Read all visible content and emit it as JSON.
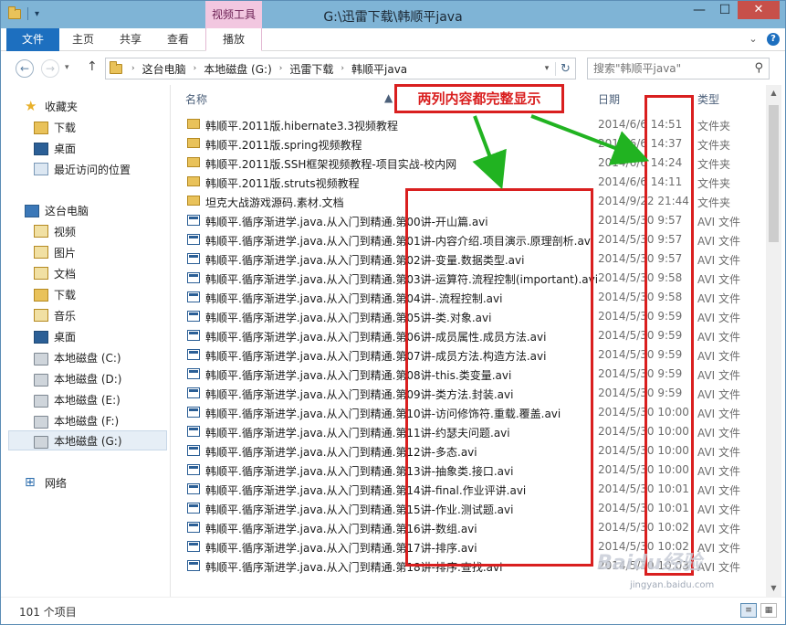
{
  "window": {
    "title": "G:\\迅雷下载\\韩顺平java",
    "context_tool": "视频工具",
    "min_glyph": "—",
    "max_glyph": "☐",
    "close_glyph": "✕"
  },
  "ribbon": {
    "tabs": [
      "文件",
      "主页",
      "共享",
      "查看",
      "播放"
    ]
  },
  "address": {
    "crumbs": [
      "这台电脑",
      "本地磁盘 (G:)",
      "迅雷下载",
      "韩顺平java"
    ]
  },
  "search": {
    "placeholder": "搜索\"韩顺平java\""
  },
  "navpane": {
    "items": [
      {
        "label": "收藏夹",
        "icon": "star-icon"
      },
      {
        "label": "下载",
        "icon": "folder-icon"
      },
      {
        "label": "桌面",
        "icon": "desktop-icon"
      },
      {
        "label": "最近访问的位置",
        "icon": "recent-icon"
      },
      {
        "label": "这台电脑",
        "icon": "computer-icon"
      },
      {
        "label": "视频",
        "icon": "library-icon"
      },
      {
        "label": "图片",
        "icon": "library-icon"
      },
      {
        "label": "文档",
        "icon": "library-icon"
      },
      {
        "label": "下载",
        "icon": "folder-icon"
      },
      {
        "label": "音乐",
        "icon": "library-icon"
      },
      {
        "label": "桌面",
        "icon": "desktop-icon"
      },
      {
        "label": "本地磁盘 (C:)",
        "icon": "drive-icon"
      },
      {
        "label": "本地磁盘 (D:)",
        "icon": "drive-icon"
      },
      {
        "label": "本地磁盘 (E:)",
        "icon": "drive-icon"
      },
      {
        "label": "本地磁盘 (F:)",
        "icon": "drive-icon"
      },
      {
        "label": "本地磁盘 (G:)",
        "icon": "drive-icon"
      },
      {
        "label": "网络",
        "icon": "network-icon"
      }
    ]
  },
  "columns": {
    "name": "名称",
    "date": "日期",
    "type": "类型"
  },
  "files": [
    {
      "name": "韩顺平.2011版.hibernate3.3视频教程",
      "date": "2014/6/6 14:51",
      "type": "文件夹",
      "kind": "folder"
    },
    {
      "name": "韩顺平.2011版.spring视频教程",
      "date": "2014/6/6 14:37",
      "type": "文件夹",
      "kind": "folder"
    },
    {
      "name": "韩顺平.2011版.SSH框架视频教程-项目实战-校内网",
      "date": "2014/6/6 14:24",
      "type": "文件夹",
      "kind": "folder"
    },
    {
      "name": "韩顺平.2011版.struts视频教程",
      "date": "2014/6/6 14:11",
      "type": "文件夹",
      "kind": "folder"
    },
    {
      "name": "坦克大战游戏源码.素材.文档",
      "date": "2014/9/22 21:44",
      "type": "文件夹",
      "kind": "folder"
    },
    {
      "name": "韩顺平.循序渐进学.java.从入门到精通.第00讲-开山篇.avi",
      "date": "2014/5/30 9:57",
      "type": "AVI 文件",
      "kind": "video"
    },
    {
      "name": "韩顺平.循序渐进学.java.从入门到精通.第01讲-内容介绍.项目演示.原理剖析.avi",
      "date": "2014/5/30 9:57",
      "type": "AVI 文件",
      "kind": "video"
    },
    {
      "name": "韩顺平.循序渐进学.java.从入门到精通.第02讲-变量.数据类型.avi",
      "date": "2014/5/30 9:57",
      "type": "AVI 文件",
      "kind": "video"
    },
    {
      "name": "韩顺平.循序渐进学.java.从入门到精通.第03讲-运算符.流程控制(important).avi",
      "date": "2014/5/30 9:58",
      "type": "AVI 文件",
      "kind": "video"
    },
    {
      "name": "韩顺平.循序渐进学.java.从入门到精通.第04讲-.流程控制.avi",
      "date": "2014/5/30 9:58",
      "type": "AVI 文件",
      "kind": "video"
    },
    {
      "name": "韩顺平.循序渐进学.java.从入门到精通.第05讲-类.对象.avi",
      "date": "2014/5/30 9:59",
      "type": "AVI 文件",
      "kind": "video"
    },
    {
      "name": "韩顺平.循序渐进学.java.从入门到精通.第06讲-成员属性.成员方法.avi",
      "date": "2014/5/30 9:59",
      "type": "AVI 文件",
      "kind": "video"
    },
    {
      "name": "韩顺平.循序渐进学.java.从入门到精通.第07讲-成员方法.构造方法.avi",
      "date": "2014/5/30 9:59",
      "type": "AVI 文件",
      "kind": "video"
    },
    {
      "name": "韩顺平.循序渐进学.java.从入门到精通.第08讲-this.类变量.avi",
      "date": "2014/5/30 9:59",
      "type": "AVI 文件",
      "kind": "video"
    },
    {
      "name": "韩顺平.循序渐进学.java.从入门到精通.第09讲-类方法.封装.avi",
      "date": "2014/5/30 9:59",
      "type": "AVI 文件",
      "kind": "video"
    },
    {
      "name": "韩顺平.循序渐进学.java.从入门到精通.第10讲-访问修饰符.重载.覆盖.avi",
      "date": "2014/5/30 10:00",
      "type": "AVI 文件",
      "kind": "video"
    },
    {
      "name": "韩顺平.循序渐进学.java.从入门到精通.第11讲-约瑟夫问题.avi",
      "date": "2014/5/30 10:00",
      "type": "AVI 文件",
      "kind": "video"
    },
    {
      "name": "韩顺平.循序渐进学.java.从入门到精通.第12讲-多态.avi",
      "date": "2014/5/30 10:00",
      "type": "AVI 文件",
      "kind": "video"
    },
    {
      "name": "韩顺平.循序渐进学.java.从入门到精通.第13讲-抽象类.接口.avi",
      "date": "2014/5/30 10:00",
      "type": "AVI 文件",
      "kind": "video"
    },
    {
      "name": "韩顺平.循序渐进学.java.从入门到精通.第14讲-final.作业评讲.avi",
      "date": "2014/5/30 10:01",
      "type": "AVI 文件",
      "kind": "video"
    },
    {
      "name": "韩顺平.循序渐进学.java.从入门到精通.第15讲-作业.测试题.avi",
      "date": "2014/5/30 10:01",
      "type": "AVI 文件",
      "kind": "video"
    },
    {
      "name": "韩顺平.循序渐进学.java.从入门到精通.第16讲-数组.avi",
      "date": "2014/5/30 10:02",
      "type": "AVI 文件",
      "kind": "video"
    },
    {
      "name": "韩顺平.循序渐进学.java.从入门到精通.第17讲-排序.avi",
      "date": "2014/5/30 10:02",
      "type": "AVI 文件",
      "kind": "video"
    },
    {
      "name": "韩顺平.循序渐进学.java.从入门到精通.第18讲-排序.查找.avi",
      "date": "2014/5/30 10:03",
      "type": "AVI 文件",
      "kind": "video"
    }
  ],
  "status": {
    "count": "101 个项目"
  },
  "annotation": {
    "label": "两列内容都完整显示",
    "color": "#d91f1f"
  },
  "watermark": {
    "brand": "Baidu经验",
    "url": "jingyan.baidu.com"
  }
}
